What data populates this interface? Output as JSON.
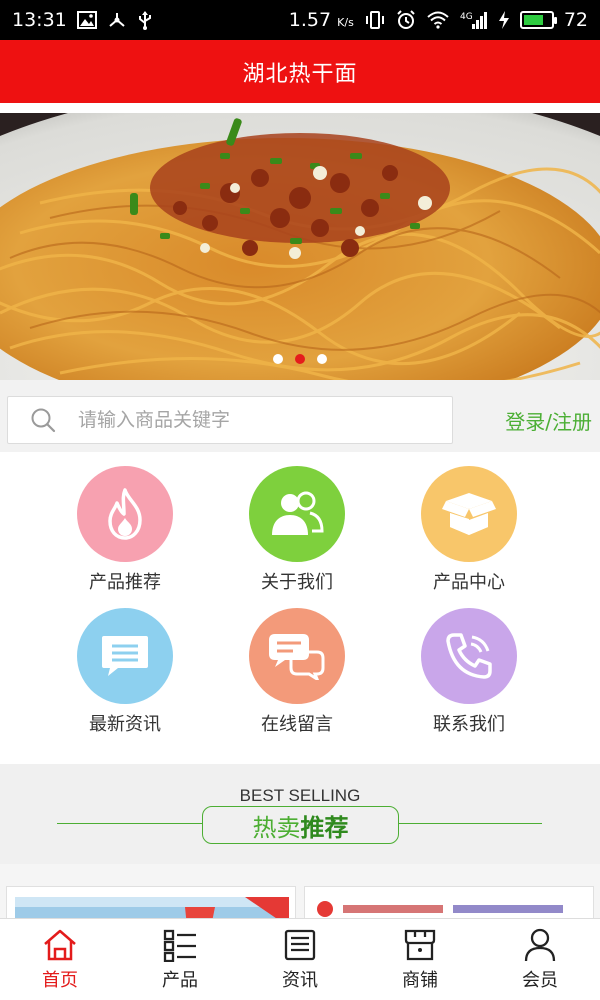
{
  "status_bar": {
    "time": "13:31",
    "speed": "1.57",
    "speed_unit": "K/s",
    "network": "4G",
    "battery": "72",
    "battery_level": 0.72,
    "icons": [
      "image-icon",
      "share-icon",
      "usb-icon",
      "vibrate-icon",
      "alarm-icon",
      "wifi-icon",
      "signal-icon",
      "charging-icon",
      "battery-icon"
    ]
  },
  "header": {
    "title": "湖北热干面"
  },
  "banner": {
    "slides": 3,
    "active_slide": 2
  },
  "search": {
    "placeholder": "请输入商品关键字",
    "login_label": "登录/注册"
  },
  "features": [
    {
      "label": "产品推荐",
      "icon": "flame-icon",
      "color": "#f7a1b0"
    },
    {
      "label": "关于我们",
      "icon": "users-icon",
      "color": "#7ed03d"
    },
    {
      "label": "产品中心",
      "icon": "box-icon",
      "color": "#f8c66a"
    },
    {
      "label": "最新资讯",
      "icon": "message-icon",
      "color": "#8dd0ef"
    },
    {
      "label": "在线留言",
      "icon": "chat-icon",
      "color": "#f39a7a"
    },
    {
      "label": "联系我们",
      "icon": "phone-icon",
      "color": "#c9a6ea"
    }
  ],
  "best_selling": {
    "en": "BEST SELLING",
    "cn_a": "热卖",
    "cn_b": "推荐"
  },
  "tabs": [
    {
      "label": "首页",
      "icon": "home-icon",
      "active": true
    },
    {
      "label": "产品",
      "icon": "list-icon",
      "active": false
    },
    {
      "label": "资讯",
      "icon": "news-icon",
      "active": false
    },
    {
      "label": "商铺",
      "icon": "store-icon",
      "active": false
    },
    {
      "label": "会员",
      "icon": "user-icon",
      "active": false
    }
  ],
  "colors": {
    "header_red": "#ee1111",
    "accent_green": "#4caf35",
    "tab_active": "#e31b1b"
  }
}
